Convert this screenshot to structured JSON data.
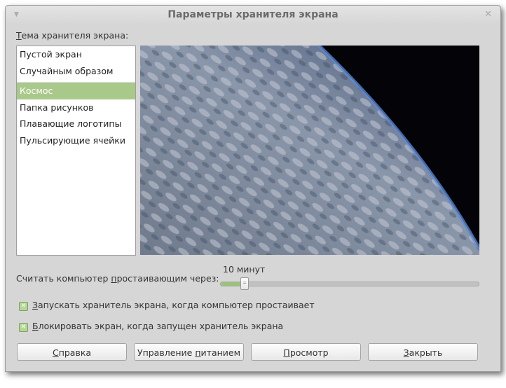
{
  "window": {
    "title": "Параметры хранителя экрана"
  },
  "theme_label": {
    "u": "Т",
    "rest": "ема хранителя экрана:"
  },
  "themes": [
    {
      "label": "Пустой экран",
      "selected": false
    },
    {
      "label": "Случайным образом",
      "selected": false
    },
    {
      "label": "Космос",
      "selected": true
    },
    {
      "label": "Папка рисунков",
      "selected": false
    },
    {
      "label": "Плавающие логотипы",
      "selected": false
    },
    {
      "label": "Пульсирующие ячейки",
      "selected": false
    }
  ],
  "idle": {
    "label_pre": "Считать компьютер ",
    "label_u": "п",
    "label_post": "ростаивающим через:",
    "value_text": "10 минут",
    "fraction": 0.09
  },
  "checkboxes": [
    {
      "u": "З",
      "rest": "апускать хранитель экрана, когда компьютер простаивает",
      "checked": true
    },
    {
      "u": "Б",
      "rest": "локировать экран, когда запущен хранитель экрана",
      "checked": true
    }
  ],
  "buttons": {
    "help": {
      "u": "С",
      "rest": "правка"
    },
    "power": {
      "pre": "Управление ",
      "u": "п",
      "rest": "итанием"
    },
    "preview": {
      "u": "П",
      "rest": "росмотр"
    },
    "close": {
      "u": "З",
      "rest": "акрыть"
    }
  },
  "colors": {
    "selection": "#a9c98a",
    "accent": "#9cc27a"
  }
}
